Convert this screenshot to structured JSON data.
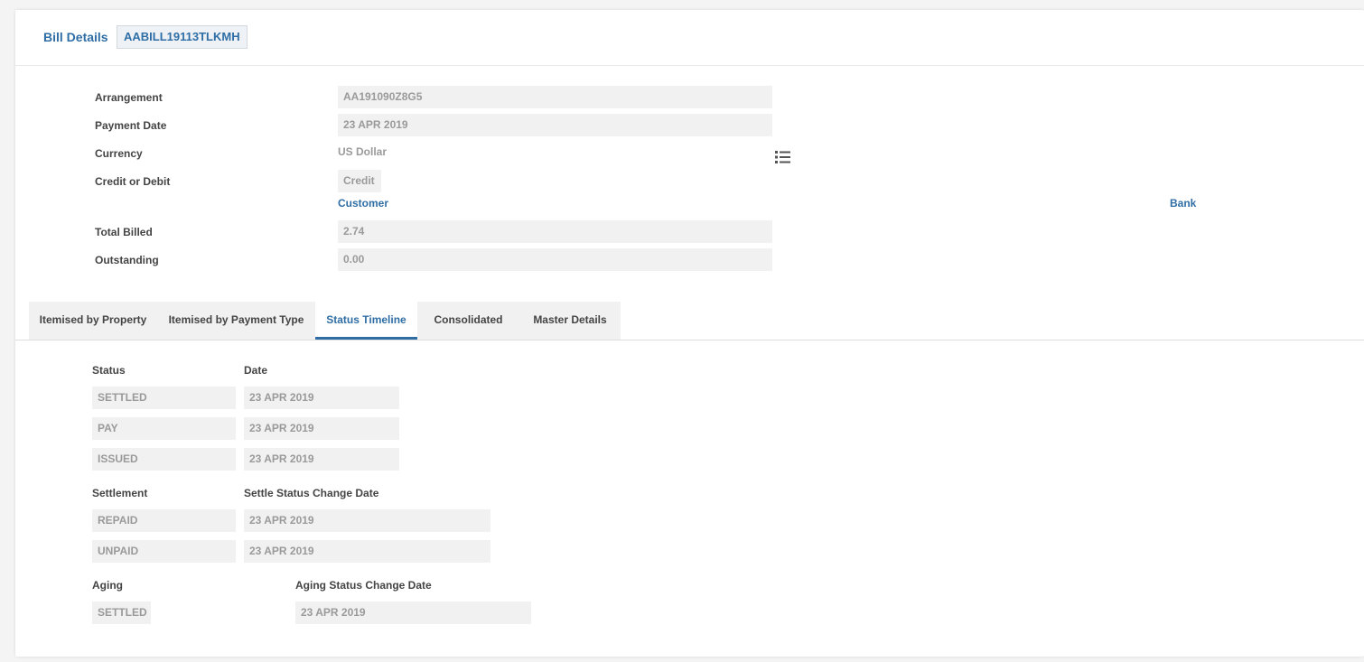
{
  "header": {
    "title": "Bill Details",
    "bill_id": "AABILL19113TLKMH"
  },
  "details": {
    "arrangement_label": "Arrangement",
    "arrangement_value": "AA191090Z8G5",
    "payment_date_label": "Payment Date",
    "payment_date_value": "23 APR 2019",
    "currency_label": "Currency",
    "currency_value": "US Dollar",
    "currency_icon": "list-icon",
    "credit_debit_label": "Credit or Debit",
    "credit_debit_value": "Credit",
    "customer_link": "Customer",
    "bank_link": "Bank",
    "total_billed_label": "Total Billed",
    "total_billed_value": "2.74",
    "outstanding_label": "Outstanding",
    "outstanding_value": "0.00"
  },
  "tabs": [
    {
      "label": "Itemised by Property"
    },
    {
      "label": "Itemised by Payment Type"
    },
    {
      "label": "Status Timeline"
    },
    {
      "label": "Consolidated"
    },
    {
      "label": "Master Details"
    }
  ],
  "status_timeline": {
    "status_header": "Status",
    "date_header": "Date",
    "status_rows": [
      {
        "status": "SETTLED",
        "date": "23 APR 2019"
      },
      {
        "status": "PAY",
        "date": "23 APR 2019"
      },
      {
        "status": "ISSUED",
        "date": "23 APR 2019"
      }
    ],
    "settlement_header": "Settlement",
    "settle_date_header": "Settle Status Change Date",
    "settlement_rows": [
      {
        "status": "REPAID",
        "date": "23 APR 2019"
      },
      {
        "status": "UNPAID",
        "date": "23 APR 2019"
      }
    ],
    "aging_header": "Aging",
    "aging_date_header": "Aging Status Change Date",
    "aging_rows": [
      {
        "status": "SETTLED",
        "date": "23 APR 2019"
      }
    ]
  },
  "colors": {
    "accent": "#2f6ea5",
    "field_bg": "#f1f1f1",
    "field_text": "#9a9a9a"
  }
}
